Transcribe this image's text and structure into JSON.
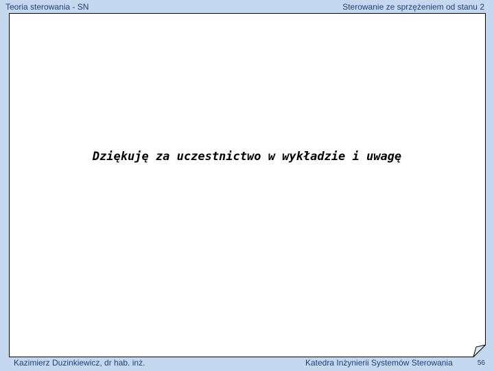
{
  "header": {
    "left": "Teoria sterowania - SN",
    "right": "Sterowanie ze sprzężeniem od stanu 2"
  },
  "main": {
    "message": "Dziękuję za uczestnictwo w wykładzie i uwagę"
  },
  "footer": {
    "author": "Kazimierz Duzinkiewicz, dr hab. inż.",
    "department": "Katedra Inżynierii Systemów Sterowania",
    "page_number": "56"
  },
  "colors": {
    "background": "#c5d8ef",
    "sheet": "#ffffff",
    "sheet_border": "#000000",
    "header_text": "#1f3f7a",
    "message_text": "#000000"
  }
}
